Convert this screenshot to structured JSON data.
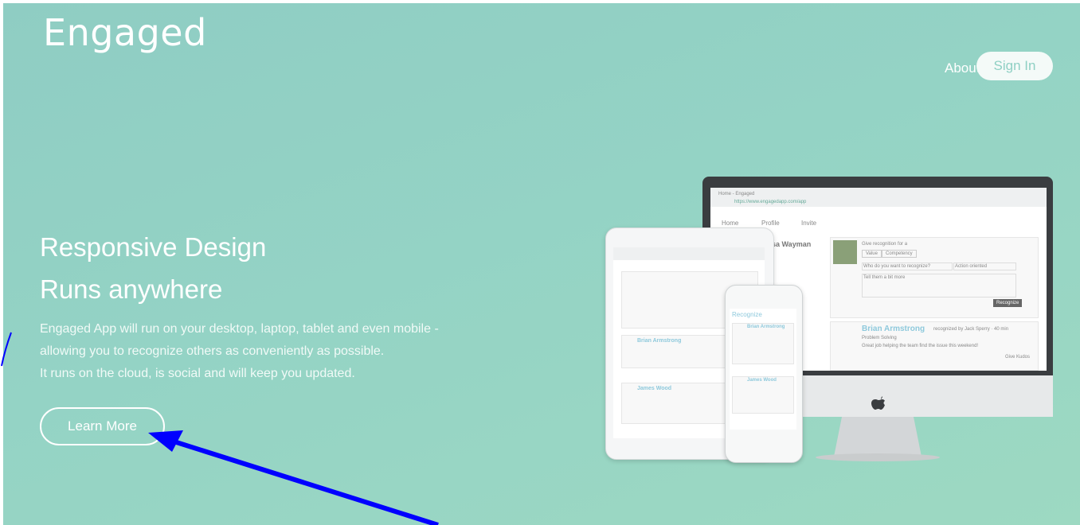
{
  "brand": "Engaged",
  "nav": {
    "about": "About",
    "sign_in": "Sign In"
  },
  "hero": {
    "headline_1": "Responsive Design",
    "headline_2": "Runs anywhere",
    "description": [
      "Engaged App will run on your desktop, laptop, tablet and even mobile -",
      "allowing you to recognize others as conveniently as possible.",
      "It runs on the cloud, is social and will keep you updated."
    ],
    "cta": "Learn More"
  },
  "mockup": {
    "browser_tab": "Home - Engaged",
    "address": "https://www.engagedapp.com/app",
    "tabs": [
      "Home",
      "Profile",
      "Invite"
    ],
    "profile_name": "elissa Wayman",
    "give_recognition": "Give recognition for a",
    "value_btn": "Value",
    "competency_btn": "Competency",
    "who_placeholder": "Who do you want to recognize?",
    "action_option": "Action oriented",
    "say_thanks": "Tell them a bit more",
    "recognize_btn": "Recognize",
    "feed_name": "Brian Armstrong",
    "feed_meta": "recognized by Jack Sperry · 40 min",
    "feed_tag": "Problem Solving",
    "feed_text": "Great job helping the team find the issue this weekend!",
    "give_kudos": "Give Kudos",
    "phone_title": "Recognize",
    "phone_name_2": "James Wood"
  },
  "colors": {
    "accent": "#8fd0c4",
    "annotation": "#0000ff"
  },
  "icons": [
    "home-icon",
    "user-icon",
    "add-user-icon",
    "gear-icon",
    "apple-logo-icon"
  ]
}
